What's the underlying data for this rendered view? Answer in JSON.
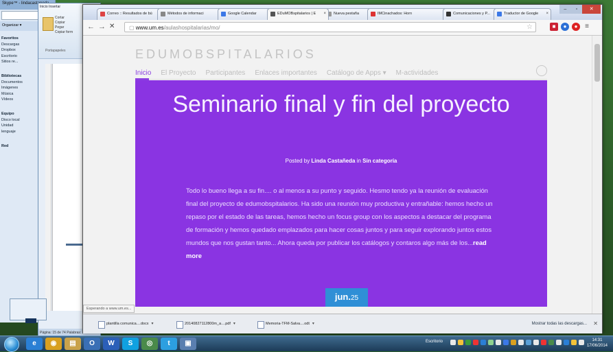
{
  "explorer": {
    "title": "Skype™ - lindacastaneda",
    "organizer_label": "Organizar ▾",
    "tree": [
      "Favoritos",
      "Descargas",
      "Dropbox",
      "Escritorio",
      "Sitios re...",
      "",
      "Bibliotecas",
      "Documentos",
      "Imágenes",
      "Música",
      "Vídeos",
      "",
      "Equipo",
      "Disco local",
      "Unidad",
      "lenguaje",
      "",
      "Red"
    ]
  },
  "word": {
    "tabs": "Inicio   Insertar",
    "ribbon_items": [
      "Cortar",
      "Copiar",
      "Pegar",
      "Copiar form"
    ],
    "group_label": "Portapapeles",
    "status": "Página: 15 de 74   Palabras:"
  },
  "chrome": {
    "tabs": [
      {
        "label": "Correo :: Resultados de bú",
        "color": "#d44"
      },
      {
        "label": "Métodos de informaci",
        "color": "#888"
      },
      {
        "label": "Google Calendar",
        "color": "#3b78e7"
      },
      {
        "label": "EDuMOBspitalarios | E",
        "color": "#555"
      },
      {
        "label": "Nueva pestaña",
        "color": "#999"
      },
      {
        "label": "IMCinachados: Horn",
        "color": "#d33"
      },
      {
        "label": "Comunicaciones y P...",
        "color": "#333"
      },
      {
        "label": "Traductor de Google",
        "color": "#3b78e7"
      }
    ],
    "url_host": "www.um.es",
    "url_path": "/aulashospitalarias/mo/",
    "status_text": "Esperando a www.um.es...",
    "downloads": [
      {
        "name": "plantilla comunica....docx"
      },
      {
        "name": "20140827112800m_a....pdf"
      },
      {
        "name": "Memoria-TFM-Salva....odt"
      }
    ],
    "show_all_downloads": "Mostrar todas las descargas..."
  },
  "site": {
    "title": "EDUMOBSPITALARIOS",
    "nav": [
      "Inicio",
      "El Proyecto",
      "Participantes",
      "Enlaces importantes",
      "Catálogo de Apps ▾",
      "M-actividades"
    ],
    "post_title": "Seminario final y fin del proyecto",
    "posted_by_prefix": "Posted by",
    "author": "Linda Castañeda",
    "in_word": "in",
    "category": "Sin categoría",
    "excerpt": "Todo lo bueno llega a su fin.... o al menos a su punto y seguido. Hesmo tendo ya la reunión de evaluación final del proyecto de edumobspitalarios. Ha sido una reunión muy productiva y entrañable: hemos hecho un repaso por el estado de las tareas, hemos hecho un focus group con los aspectos a destacar del programa de formación y hemos quedado emplazados para hacer cosas juntos y para seguir explorando juntos estos mundos que nos gustan tanto... Ahora queda por publicar los catálogos y contaros algo más de los...",
    "read_more": "read more",
    "date_month": "jun.",
    "date_day": "25"
  },
  "taskbar": {
    "tray_language": "Escritorio",
    "clock_time": "14:31",
    "clock_date": "17/06/2014",
    "app_icons": [
      {
        "name": "ie",
        "color": "#2a7fd4",
        "glyph": "e"
      },
      {
        "name": "chrome",
        "color": "#d8a020",
        "glyph": "◉"
      },
      {
        "name": "folder",
        "color": "#c9a24a",
        "glyph": "▤"
      },
      {
        "name": "outlook",
        "color": "#3a6fb5",
        "glyph": "O"
      },
      {
        "name": "word",
        "color": "#2b5fb8",
        "glyph": "W"
      },
      {
        "name": "skype",
        "color": "#10a1e0",
        "glyph": "S"
      },
      {
        "name": "network",
        "color": "#4a8a4a",
        "glyph": "◎"
      },
      {
        "name": "twitter",
        "color": "#2c9fe0",
        "glyph": "t"
      },
      {
        "name": "picture",
        "color": "#5a7fb0",
        "glyph": "▣"
      }
    ]
  },
  "colors": {
    "accent_purple": "#8a34e2",
    "date_badge": "#2f8fd6"
  }
}
